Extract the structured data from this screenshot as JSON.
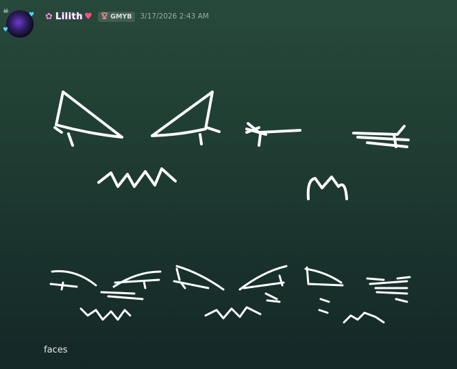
{
  "message": {
    "author": {
      "name": "Lilith",
      "flower_icon": "flower-icon",
      "heart_icon": "heart-icon",
      "name_color": "#ffffff"
    },
    "guild_tag": {
      "icon": "trophy-icon",
      "label": "GMYB"
    },
    "timestamp": "3/17/2026 2:43 AM",
    "attachment": {
      "description_icon": "drawing-faces",
      "stroke_color": "#ffffff"
    },
    "content": "faces"
  }
}
